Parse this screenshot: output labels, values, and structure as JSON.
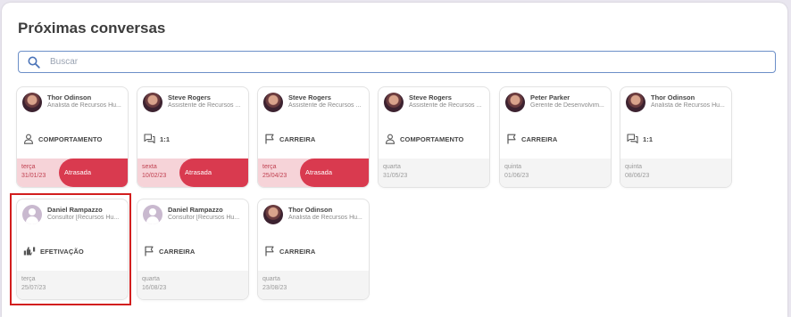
{
  "page_title": "Próximas conversas",
  "search": {
    "placeholder": "Buscar"
  },
  "status_label_late": "Atrasada",
  "colors": {
    "late_badge": "#d93a4f",
    "late_footer": "#f6d3d8",
    "search_border": "#6c8fc8",
    "highlight": "#d21e1e"
  },
  "cards": [
    {
      "name": "Thor Odinson",
      "role": "Analista de Recursos Hu...",
      "type": "COMPORTAMENTO",
      "icon": "person-icon",
      "day": "terça",
      "date": "31/01/23",
      "late": true,
      "avatar": "photo"
    },
    {
      "name": "Steve Rogers",
      "role": "Assistente de Recursos ...",
      "type": "1:1",
      "icon": "chat-icon",
      "day": "sexta",
      "date": "10/02/23",
      "late": true,
      "avatar": "photo"
    },
    {
      "name": "Steve Rogers",
      "role": "Assistente de Recursos ...",
      "type": "CARREIRA",
      "icon": "flag-icon",
      "day": "terça",
      "date": "25/04/23",
      "late": true,
      "avatar": "photo"
    },
    {
      "name": "Steve Rogers",
      "role": "Assistente de Recursos ...",
      "type": "COMPORTAMENTO",
      "icon": "person-icon",
      "day": "quarta",
      "date": "31/05/23",
      "late": false,
      "avatar": "photo"
    },
    {
      "name": "Peter Parker",
      "role": "Gerente de Desenvolvim...",
      "type": "CARREIRA",
      "icon": "flag-icon",
      "day": "quinta",
      "date": "01/06/23",
      "late": false,
      "avatar": "photo"
    },
    {
      "name": "Thor Odinson",
      "role": "Analista de Recursos Hu...",
      "type": "1:1",
      "icon": "chat-icon",
      "day": "quinta",
      "date": "08/06/23",
      "late": false,
      "avatar": "photo"
    },
    {
      "name": "Daniel Rampazzo",
      "role": "Consultor [Recursos Hu...",
      "type": "EFETIVAÇÃO",
      "icon": "thumbs-icon",
      "day": "terça",
      "date": "25/07/23",
      "late": false,
      "avatar": "default"
    },
    {
      "name": "Daniel Rampazzo",
      "role": "Consultor [Recursos Hu...",
      "type": "CARREIRA",
      "icon": "flag-icon",
      "day": "quarta",
      "date": "16/08/23",
      "late": false,
      "avatar": "default"
    },
    {
      "name": "Thor Odinson",
      "role": "Analista de Recursos Hu...",
      "type": "CARREIRA",
      "icon": "flag-icon",
      "day": "quarta",
      "date": "23/08/23",
      "late": false,
      "avatar": "photo"
    }
  ]
}
